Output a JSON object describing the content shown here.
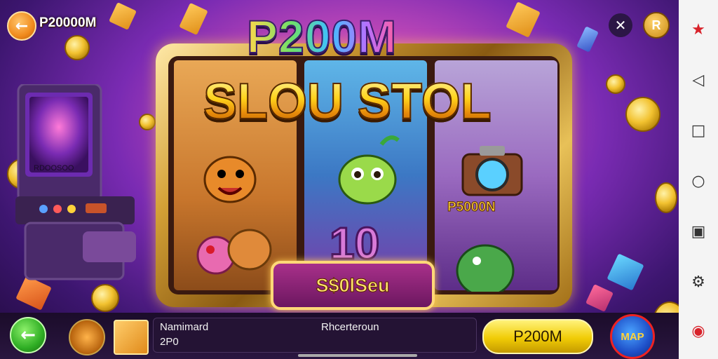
{
  "topbar": {
    "balance": "P20000M",
    "back_icon": "arrow-left-icon",
    "close_icon": "close-icon",
    "r_button_label": "R"
  },
  "machine": {
    "title_top": "P200M",
    "title_main": "SLOU STOL",
    "symbol_label": "P5000N",
    "reel_number": "10",
    "spin_label": "S$0lSeu",
    "arcade_screen_text": "RDOOSOO"
  },
  "bottombar": {
    "player_name": "Namimard",
    "player_value": "2P0",
    "right_label": "Rhcerteroun",
    "action_label": "P200M",
    "map_label": "MAP"
  },
  "colors": {
    "accent_gold": "#f2c230",
    "spin_purple": "#6c1760",
    "green": "#2fae24",
    "yellow": "#f1cc06"
  },
  "system_nav": {
    "icons": [
      "accessibility-icon",
      "back-triangle-icon",
      "recents-square-icon",
      "home-circle-icon",
      "screenshot-icon",
      "gamepad-icon",
      "record-icon"
    ]
  }
}
